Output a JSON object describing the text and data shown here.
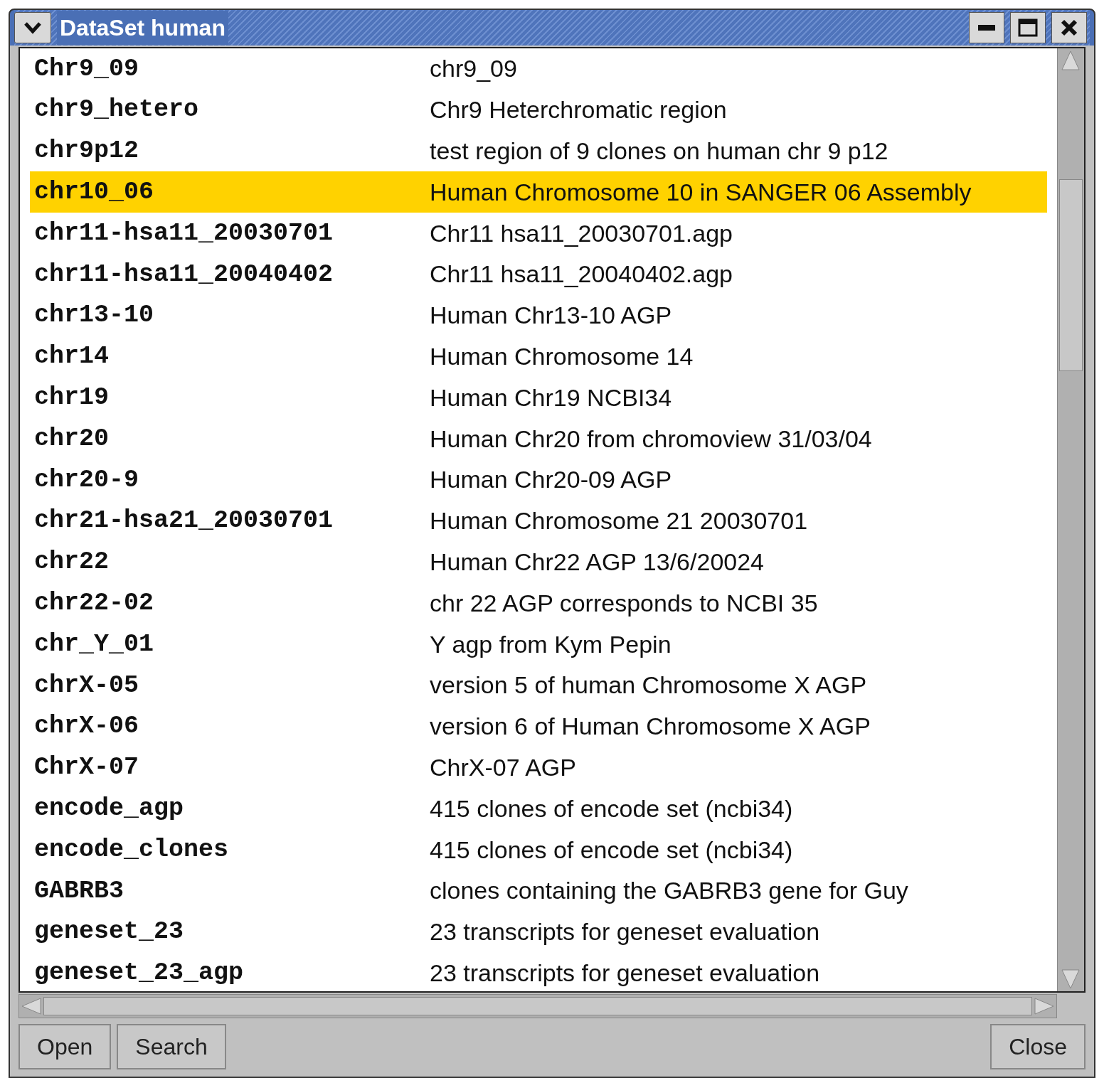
{
  "window": {
    "title": "DataSet human"
  },
  "rows": [
    {
      "name": "Chr9_09",
      "description": "chr9_09",
      "selected": false
    },
    {
      "name": "chr9_hetero",
      "description": "Chr9 Heterchromatic region",
      "selected": false
    },
    {
      "name": "chr9p12",
      "description": "test region of 9 clones on human chr 9 p12",
      "selected": false
    },
    {
      "name": "chr10_06",
      "description": "Human Chromosome 10 in SANGER 06 Assembly",
      "selected": true
    },
    {
      "name": "chr11-hsa11_20030701",
      "description": "Chr11 hsa11_20030701.agp",
      "selected": false
    },
    {
      "name": "chr11-hsa11_20040402",
      "description": "Chr11 hsa11_20040402.agp",
      "selected": false
    },
    {
      "name": "chr13-10",
      "description": "Human Chr13-10 AGP",
      "selected": false
    },
    {
      "name": "chr14",
      "description": "Human Chromosome 14",
      "selected": false
    },
    {
      "name": "chr19",
      "description": "Human Chr19 NCBI34",
      "selected": false
    },
    {
      "name": "chr20",
      "description": "Human Chr20 from chromoview 31/03/04",
      "selected": false
    },
    {
      "name": "chr20-9",
      "description": "Human Chr20-09 AGP",
      "selected": false
    },
    {
      "name": "chr21-hsa21_20030701",
      "description": "Human Chromosome 21 20030701",
      "selected": false
    },
    {
      "name": "chr22",
      "description": "Human Chr22 AGP 13/6/20024",
      "selected": false
    },
    {
      "name": "chr22-02",
      "description": "chr 22 AGP corresponds to NCBI 35",
      "selected": false
    },
    {
      "name": "chr_Y_01",
      "description": "Y agp from Kym Pepin",
      "selected": false
    },
    {
      "name": "chrX-05",
      "description": "version 5 of human Chromosome X AGP",
      "selected": false
    },
    {
      "name": "chrX-06",
      "description": "version 6 of Human Chromosome X AGP",
      "selected": false
    },
    {
      "name": "ChrX-07",
      "description": "ChrX-07 AGP",
      "selected": false
    },
    {
      "name": "encode_agp",
      "description": "415 clones of encode set (ncbi34)",
      "selected": false
    },
    {
      "name": "encode_clones",
      "description": "415 clones of encode set (ncbi34)",
      "selected": false
    },
    {
      "name": "GABRB3",
      "description": "clones containing the GABRB3 gene for Guy",
      "selected": false
    },
    {
      "name": "geneset_23",
      "description": "23 transcripts for geneset evaluation",
      "selected": false
    },
    {
      "name": "geneset_23_agp",
      "description": "23 transcripts for geneset evaluation",
      "selected": false
    }
  ],
  "buttons_left": [
    "Open",
    "Search"
  ],
  "buttons_right": [
    "Close"
  ]
}
